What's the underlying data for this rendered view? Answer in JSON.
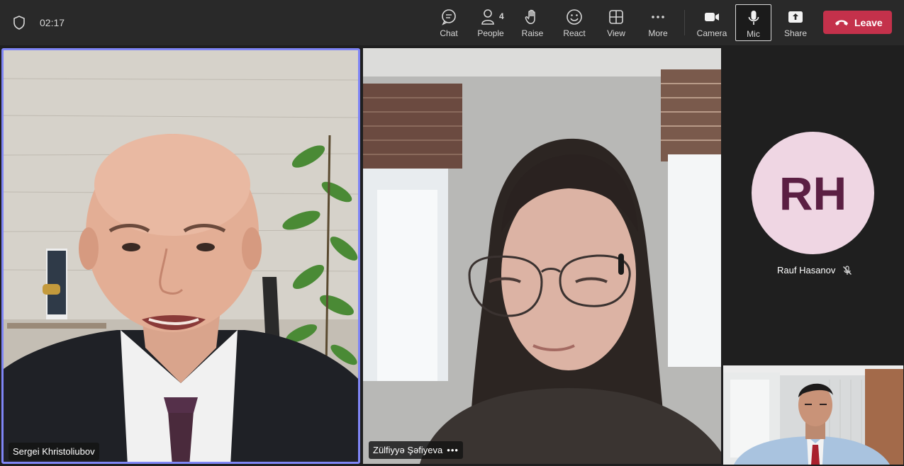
{
  "meeting": {
    "timer": "02:17"
  },
  "toolbar": {
    "chat": "Chat",
    "people": "People",
    "people_count": "4",
    "raise": "Raise",
    "react": "React",
    "view": "View",
    "more": "More",
    "camera": "Camera",
    "mic": "Mic",
    "share": "Share",
    "leave": "Leave"
  },
  "participants": [
    {
      "name": "Sergei Khristoliubov"
    },
    {
      "name": "Zülfiyyə Şəfiyeva",
      "more": "•••"
    },
    {
      "name": "Rauf Hasanov",
      "initials": "RH",
      "muted": true
    },
    {
      "name": ""
    }
  ],
  "colors": {
    "accent": "#7f85f5",
    "leave": "#c4314b",
    "avatar_bg": "#efd6e3",
    "avatar_fg": "#5b1f43"
  }
}
